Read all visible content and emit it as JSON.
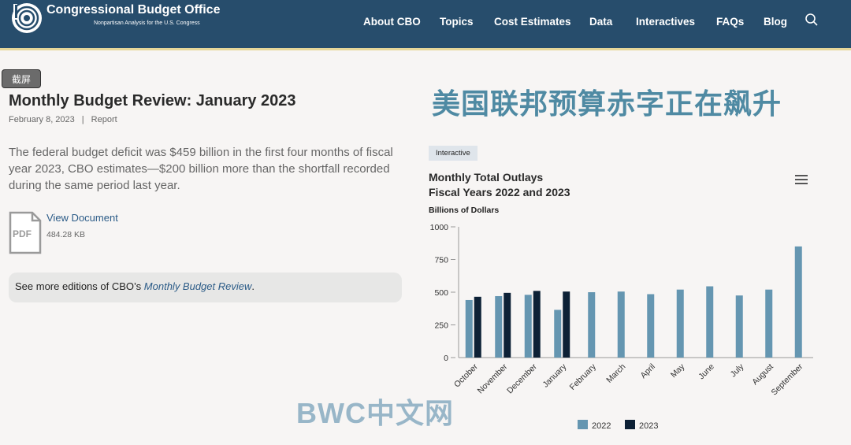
{
  "header": {
    "brand_title": "Congressional Budget Office",
    "brand_subtitle": "Nonpartisan Analysis for the U.S. Congress",
    "nav": [
      "About CBO",
      "Topics",
      "Cost Estimates",
      "Data",
      "Interactives",
      "FAQs",
      "Blog"
    ],
    "colors": {
      "bar": "#274d6c",
      "accent": "#e6d79a"
    }
  },
  "article": {
    "screenshot_tag": "截屏",
    "title": "Monthly Budget Review: January 2023",
    "date": "February 8, 2023",
    "type": "Report",
    "summary": "The federal budget deficit was $459 billion in the first four months of fiscal year 2023, CBO estimates—$200 billion more than the shortfall recorded during the same period last year.",
    "pdf_label": "PDF",
    "document_link": "View Document",
    "document_size": "484.28 KB",
    "more_prefix": "See more editions of CBO’s ",
    "more_link": "Monthly Budget Review",
    "more_suffix": "."
  },
  "overlay": {
    "headline": "美国联邦预算赤字正在飙升",
    "watermark": "BWC中文网"
  },
  "chart_panel": {
    "badge": "Interactive",
    "title_line1": "Monthly Total Outlays",
    "title_line2": "Fiscal Years 2022 and 2023",
    "unit_label": "Billions of Dollars"
  },
  "chart_data": {
    "type": "bar",
    "title": "Monthly Total Outlays Fiscal Years 2022 and 2023",
    "ylabel": "Billions of Dollars",
    "ylim": [
      0,
      1000
    ],
    "yticks": [
      0,
      250,
      500,
      750,
      1000
    ],
    "categories": [
      "October",
      "November",
      "December",
      "January",
      "February",
      "March",
      "April",
      "May",
      "June",
      "July",
      "August",
      "September"
    ],
    "series": [
      {
        "name": "2022",
        "color": "#6596b1",
        "values": [
          440,
          470,
          480,
          365,
          500,
          505,
          485,
          520,
          545,
          475,
          520,
          850
        ]
      },
      {
        "name": "2023",
        "color": "#0d2136",
        "values": [
          465,
          495,
          510,
          505,
          null,
          null,
          null,
          null,
          null,
          null,
          null,
          null
        ]
      }
    ],
    "legend_position": "bottom",
    "grid": false
  }
}
